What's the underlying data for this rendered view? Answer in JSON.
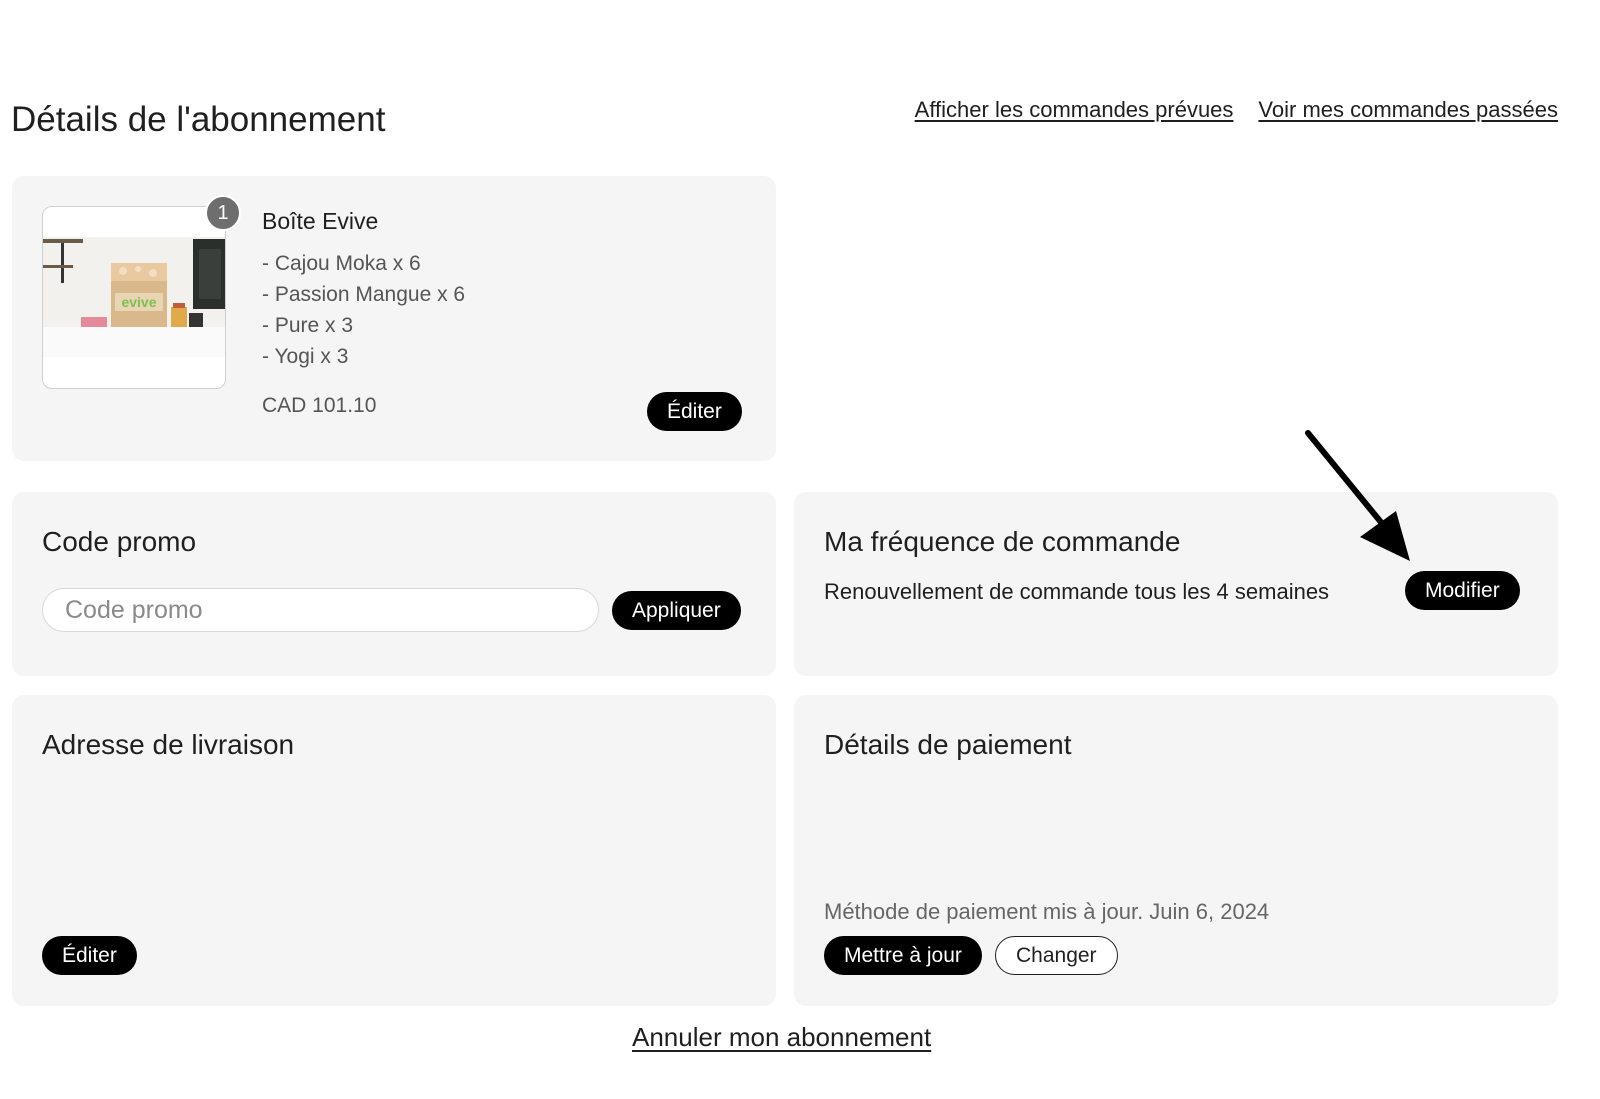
{
  "page": {
    "title": "Détails de l'abonnement",
    "links": {
      "upcoming_orders": "Afficher les commandes prévues",
      "past_orders": "Voir mes commandes passées"
    },
    "cancel_subscription": "Annuler mon abonnement"
  },
  "product": {
    "quantity_badge": "1",
    "name": "Boîte Evive",
    "items": [
      "- Cajou Moka x 6",
      "- Passion Mangue x 6",
      "- Pure x 3",
      "- Yogi x 3"
    ],
    "price": "CAD 101.10",
    "edit_label": "Éditer",
    "image_brand_text": "evive"
  },
  "promo": {
    "title": "Code promo",
    "input_value": "",
    "input_placeholder": "Code promo",
    "apply_label": "Appliquer"
  },
  "frequency": {
    "title": "Ma fréquence de commande",
    "description": "Renouvellement de commande tous les 4 semaines",
    "modify_label": "Modifier"
  },
  "address": {
    "title": "Adresse de livraison",
    "edit_label": "Éditer"
  },
  "payment": {
    "title": "Détails de paiement",
    "note": "Méthode de paiement mis à jour. Juin 6, 2024",
    "update_label": "Mettre à jour",
    "change_label": "Changer"
  },
  "colors": {
    "card_background": "#f5f5f5",
    "button_dark": "#000000",
    "text_primary": "#1f1f1f",
    "text_secondary": "#555555",
    "badge": "#6e6e6e",
    "brand_green": "#7dbf4e"
  },
  "icons": {
    "annotation": "arrow-pointer-icon"
  }
}
